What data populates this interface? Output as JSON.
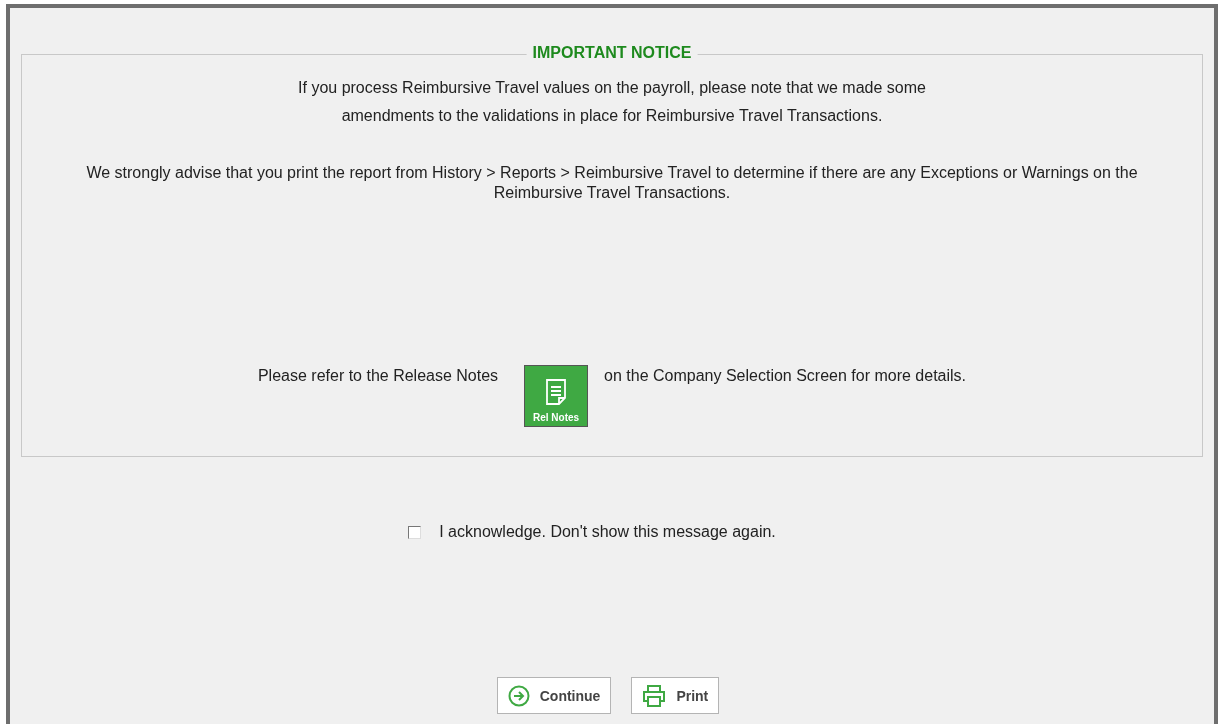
{
  "notice": {
    "title": "IMPORTANT NOTICE",
    "intro_lines": [
      "If you process Reimbursive Travel values on the payroll, please note that we made some",
      "amendments to the validations in place for Reimbursive Travel Transactions."
    ],
    "advice": "We strongly advise that you print the report from History > Reports > Reimbursive Travel to determine if there are any Exceptions or Warnings on the Reimbursive Travel Transactions.",
    "refer_before": "Please refer to the Release Notes",
    "release_notes_button": "Rel Notes",
    "refer_after": "on the Company Selection Screen for more details."
  },
  "acknowledge": {
    "label": "I acknowledge. Don't show this message again.",
    "checked": false
  },
  "buttons": [
    {
      "kind": "continue",
      "label": "Continue"
    },
    {
      "kind": "print",
      "label": "Print"
    }
  ]
}
